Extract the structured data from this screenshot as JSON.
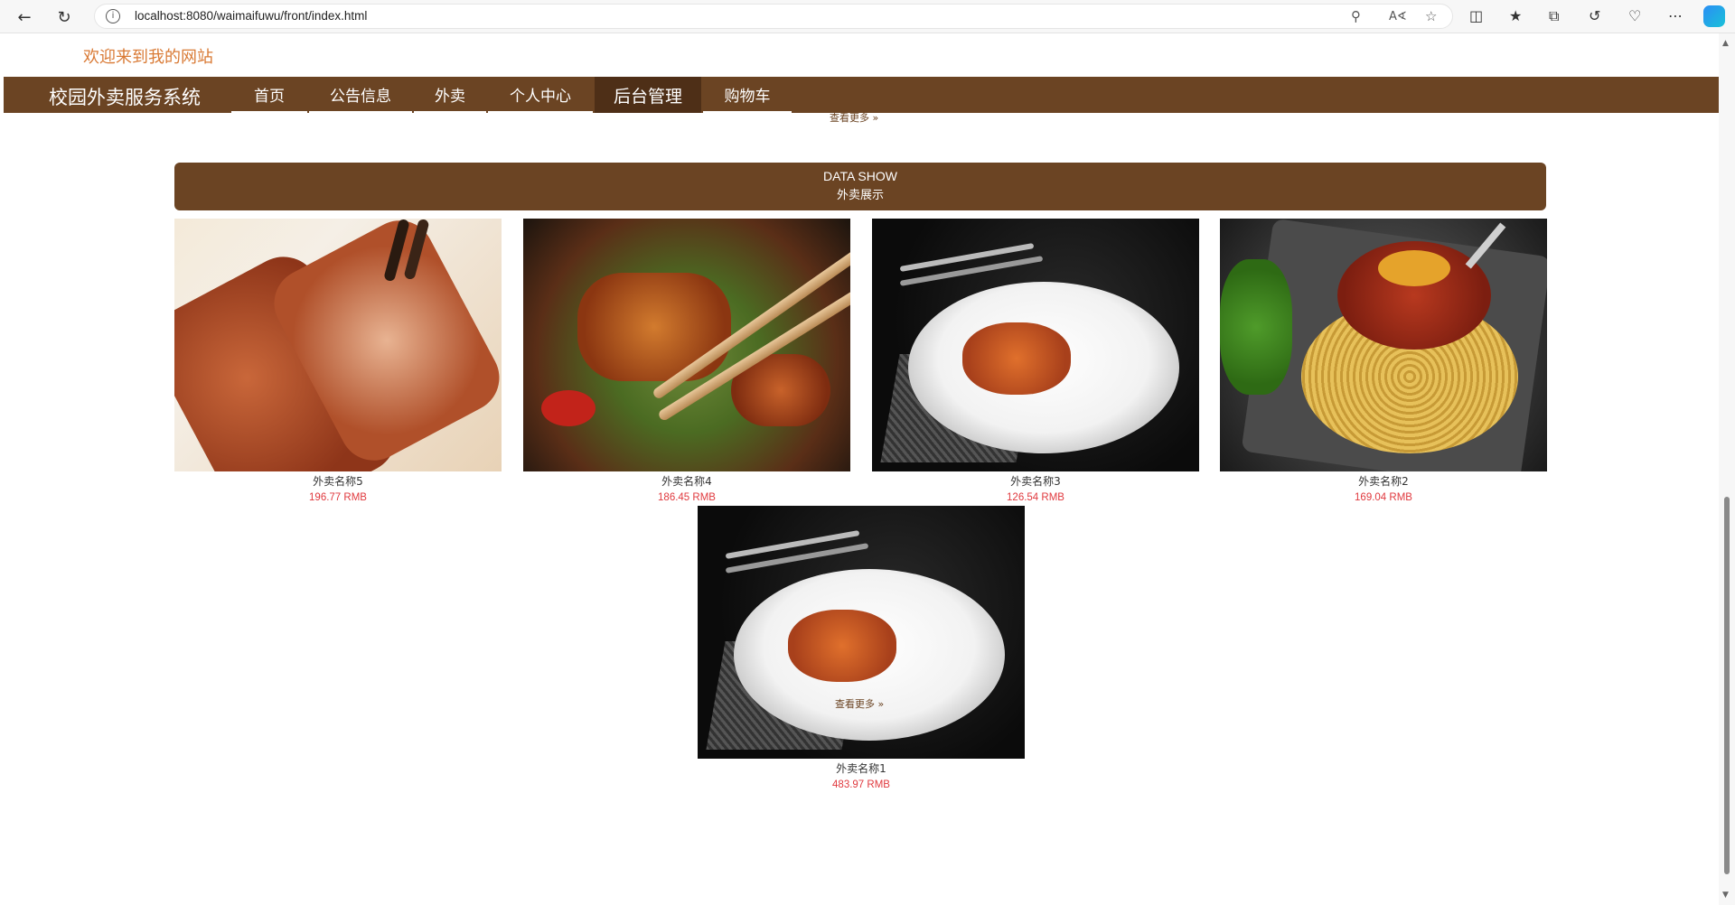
{
  "browser": {
    "url": "localhost:8080/waimaifuwu/front/index.html"
  },
  "page": {
    "welcome": "欢迎来到我的网站",
    "brand": "校园外卖服务系统",
    "nav": [
      {
        "label": "首页"
      },
      {
        "label": "公告信息"
      },
      {
        "label": "外卖"
      },
      {
        "label": "个人中心"
      },
      {
        "label": "后台管理",
        "active": true
      },
      {
        "label": "购物车"
      }
    ],
    "more_link_top": "查看更多",
    "section": {
      "title_en": "DATA SHOW",
      "title_cn": "外卖展示"
    },
    "items": [
      {
        "name": "外卖名称5",
        "price": "196.77 RMB",
        "image": "bbq-pork-photo"
      },
      {
        "name": "外卖名称4",
        "price": "186.45 RMB",
        "image": "stir-fry-photo"
      },
      {
        "name": "外卖名称3",
        "price": "126.54 RMB",
        "image": "plated-dish-photo"
      },
      {
        "name": "外卖名称2",
        "price": "169.04 RMB",
        "image": "spaghetti-photo"
      },
      {
        "name": "外卖名称1",
        "price": "483.97 RMB",
        "image": "plated-dish-photo"
      }
    ],
    "more_link_bottom": "查看更多"
  }
}
